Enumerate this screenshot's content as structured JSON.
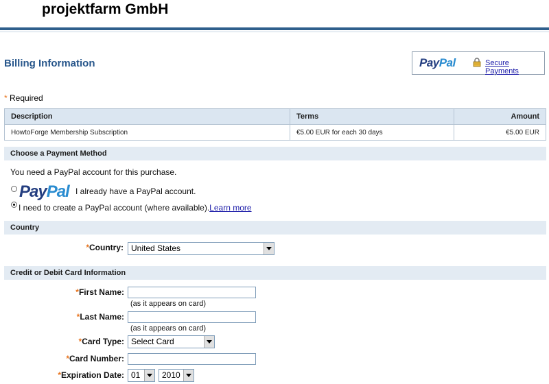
{
  "header": {
    "merchant": "projektfarm GmbH"
  },
  "billing": {
    "title": "Billing Information",
    "paypal_logo_a": "Pay",
    "paypal_logo_b": "Pal",
    "secure_link": "Secure Payments"
  },
  "required_label": "Required",
  "summary": {
    "headers": [
      "Description",
      "Terms",
      "Amount"
    ],
    "row": [
      "HowtoForge Membership Subscription",
      "€5.00 EUR for each 30 days",
      "€5.00 EUR"
    ]
  },
  "payment": {
    "section_title": "Choose a Payment Method",
    "note": "You need a PayPal account for this purchase.",
    "option1": "I already have a PayPal account.",
    "option2": "I need to create a PayPal account (where available).",
    "learn_more": "Learn more",
    "selected_option": 2
  },
  "country": {
    "section_title": "Country",
    "label": "Country:",
    "value": "United States"
  },
  "card": {
    "section_title": "Credit or Debit Card Information",
    "first_name_label": "First Name:",
    "first_name_hint": "(as it appears on card)",
    "last_name_label": "Last Name:",
    "last_name_hint": "(as it appears on card)",
    "card_type_label": "Card Type:",
    "card_type_value": "Select Card",
    "card_number_label": "Card Number:",
    "expiration_label": "Expiration Date:",
    "exp_month": "01",
    "exp_year": "2010"
  },
  "colors": {
    "accent": "#27568b",
    "bar": "#2f5f8c",
    "section_bg": "#e3ebf3",
    "required_star": "#e8731c"
  }
}
